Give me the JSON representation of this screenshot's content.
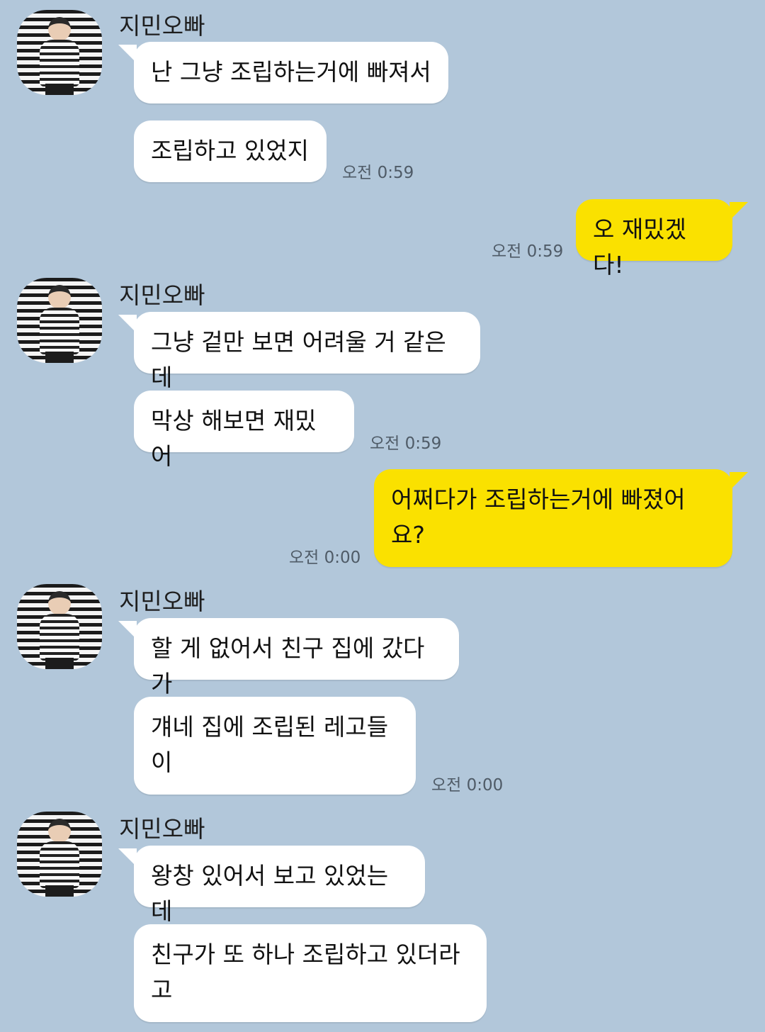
{
  "theme": {
    "background": "#b2c7da",
    "incoming_bubble": "#ffffff",
    "outgoing_bubble": "#fae100"
  },
  "chat": {
    "groups": [
      {
        "sender": "지민오빠",
        "messages": [
          "난 그냥 조립하는거에 빠져서",
          "조립하고 있었지"
        ],
        "time": "오전 0:59"
      },
      {
        "outgoing": [
          "오 재밌겠다!"
        ],
        "time": "오전 0:59"
      },
      {
        "sender": "지민오빠",
        "messages": [
          "그냥 겉만 보면 어려울 거 같은데",
          "막상 해보면 재밌어"
        ],
        "time": "오전 0:59"
      },
      {
        "outgoing": [
          "어쩌다가 조립하는거에 빠졌어\n요?"
        ],
        "time": "오전 0:00"
      },
      {
        "sender": "지민오빠",
        "messages": [
          "할 게 없어서 친구 집에 갔다가",
          "걔네 집에 조립된 레고들\n이"
        ],
        "time": "오전 0:00"
      },
      {
        "sender": "지민오빠",
        "messages": [
          "왕창 있어서 보고 있었는데",
          "친구가 또 하나 조립하고 있더라\n고"
        ]
      }
    ]
  }
}
